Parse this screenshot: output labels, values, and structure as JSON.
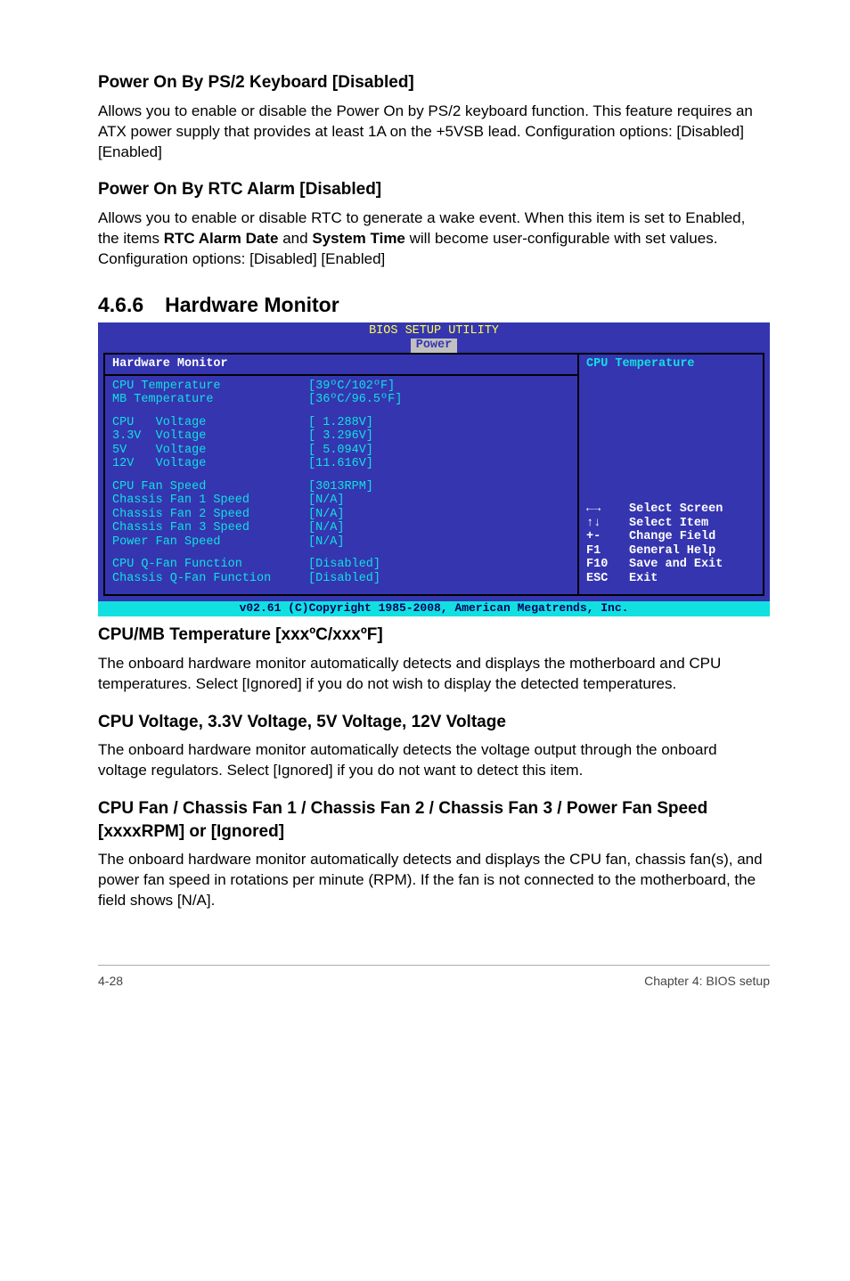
{
  "s1": {
    "title": "Power On By PS/2 Keyboard [Disabled]",
    "p": "Allows you to enable or disable the Power On by PS/2 keyboard function. This feature requires an ATX power supply that provides at least 1A on the +5VSB lead. Configuration options: [Disabled] [Enabled]"
  },
  "s2": {
    "title": "Power On By RTC Alarm [Disabled]",
    "p1a": "Allows you to enable or disable RTC to generate a wake event. When this item is set to Enabled, the items ",
    "b1": "RTC Alarm Date",
    "p1b": " and ",
    "b2": "System Time",
    "p1c": " will become user-configurable with set values.",
    "p2": "Configuration options: [Disabled] [Enabled]"
  },
  "hw": {
    "num": "4.6.6",
    "title": "Hardware Monitor"
  },
  "bios": {
    "header": "BIOS SETUP UTILITY",
    "tab": "Power",
    "panel_title": "Hardware Monitor",
    "help_title": "CPU Temperature",
    "rows": {
      "cpu_temp_l": "CPU Temperature",
      "cpu_temp_v": "[39ºC/102ºF]",
      "mb_temp_l": "MB Temperature",
      "mb_temp_v": "[36ºC/96.5ºF]",
      "cpu_v_l": "CPU   Voltage",
      "cpu_v_v": "[ 1.288V]",
      "v33_l": "3.3V  Voltage",
      "v33_v": "[ 3.296V]",
      "v5_l": "5V    Voltage",
      "v5_v": "[ 5.094V]",
      "v12_l": "12V   Voltage",
      "v12_v": "[11.616V]",
      "cfan_l": "CPU Fan Speed",
      "cfan_v": "[3013RPM]",
      "ch1_l": "Chassis Fan 1 Speed",
      "ch1_v": "[N/A]",
      "ch2_l": "Chassis Fan 2 Speed",
      "ch2_v": "[N/A]",
      "ch3_l": "Chassis Fan 3 Speed",
      "ch3_v": "[N/A]",
      "pwr_l": "Power Fan Speed",
      "pwr_v": "[N/A]",
      "cq_l": "CPU Q-Fan Function",
      "cq_v": "[Disabled]",
      "chq_l": "Chassis Q-Fan Function",
      "chq_v": "[Disabled]"
    },
    "nav": {
      "r1k": "←→",
      "r1t": "Select Screen",
      "r2k": "↑↓",
      "r2t": "Select Item",
      "r3k": "+-",
      "r3t": "Change Field",
      "r4k": "F1",
      "r4t": "General Help",
      "r5k": "F10",
      "r5t": "Save and Exit",
      "r6k": "ESC",
      "r6t": "Exit"
    },
    "footer": "v02.61 (C)Copyright 1985-2008, American Megatrends, Inc."
  },
  "s3": {
    "title": "CPU/MB Temperature [xxxºC/xxxºF]",
    "p": "The onboard hardware monitor automatically detects and displays the motherboard and CPU temperatures. Select [Ignored] if you do not wish to display the detected temperatures."
  },
  "s4": {
    "title": "CPU Voltage, 3.3V Voltage, 5V Voltage, 12V Voltage",
    "p": "The onboard hardware monitor automatically detects the voltage output through the onboard voltage regulators. Select [Ignored] if you do not want to detect this item."
  },
  "s5": {
    "title": "CPU Fan / Chassis Fan 1 / Chassis Fan 2 / Chassis Fan 3 / Power Fan Speed [xxxxRPM] or [Ignored]",
    "p": "The onboard hardware monitor automatically detects and displays the CPU fan, chassis fan(s), and power fan speed in rotations per minute (RPM). If the fan is not connected to the motherboard, the field shows [N/A]."
  },
  "footer": {
    "left": "4-28",
    "right": "Chapter 4: BIOS setup"
  }
}
